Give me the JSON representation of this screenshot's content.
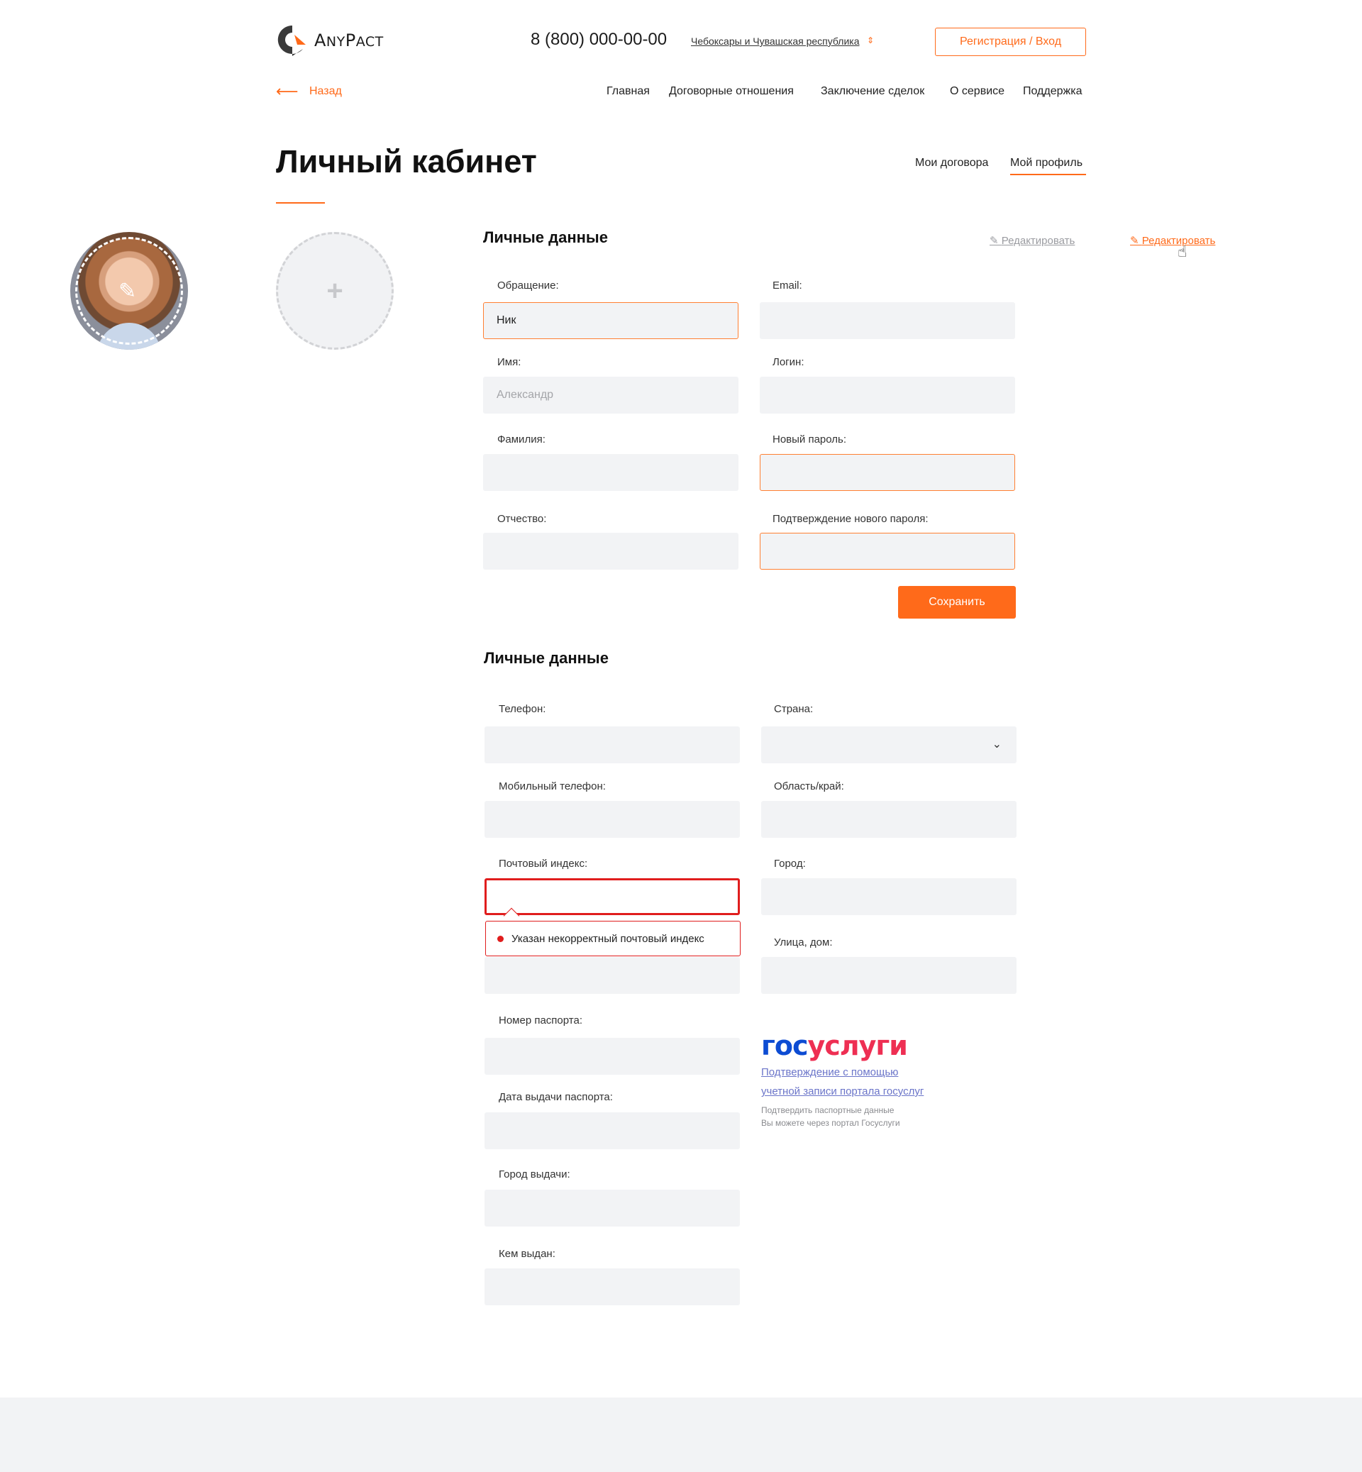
{
  "header": {
    "logo_text_cap1": "A",
    "logo_text_sc1": "NY",
    "logo_text_cap2": "P",
    "logo_text_sc2": "ACT",
    "phone": "8 (800) 000-00-00",
    "region": "Чебоксары и Чувашская республика",
    "auth_button": "Регистрация / Вход"
  },
  "nav": {
    "back": "Назад",
    "items": [
      "Главная",
      "Договорные отношения",
      "Заключение сделок",
      "О сервисе",
      "Поддержка"
    ]
  },
  "page": {
    "title": "Личный кабинет",
    "tabs": [
      "Мои договора",
      "Мой профиль"
    ],
    "active_tab": "Мой профиль"
  },
  "section1": {
    "title": "Личные данные",
    "edit_link": "Редактировать",
    "edit_link_hover": "Редактировать",
    "fields": {
      "salutation": {
        "label": "Обращение:",
        "value": "Ник"
      },
      "email": {
        "label": "Email:",
        "value": ""
      },
      "name": {
        "label": "Имя:",
        "placeholder": "Александр"
      },
      "login": {
        "label": "Логин:",
        "value": ""
      },
      "surname": {
        "label": "Фамилия:",
        "value": ""
      },
      "new_password": {
        "label": "Новый пароль:",
        "value": ""
      },
      "patronymic": {
        "label": "Отчество:",
        "value": ""
      },
      "confirm_password": {
        "label": "Подтверждение нового пароля:",
        "value": ""
      }
    },
    "save_button": "Сохранить"
  },
  "section2": {
    "title": "Личные данные",
    "fields": {
      "phone": {
        "label": "Телефон:"
      },
      "country": {
        "label": "Страна:"
      },
      "mobile": {
        "label": "Мобильный телефон:"
      },
      "region": {
        "label": "Область/край:"
      },
      "postal": {
        "label": "Почтовый индекс:"
      },
      "city": {
        "label": "Город:"
      },
      "street": {
        "label": "Улица, дом:"
      },
      "passport_number": {
        "label": "Номер паспорта:"
      },
      "passport_date": {
        "label": "Дата выдачи паспорта:"
      },
      "issue_city": {
        "label": "Город выдачи:"
      },
      "issued_by": {
        "label": "Кем выдан:"
      }
    },
    "postal_error": "Указан некорректный почтовый индекс",
    "gosuslugi": {
      "logo_part1": "гос",
      "logo_part2": "услуги",
      "link_line1": "Подтверждение с помощью",
      "link_line2": "учетной записи портала госуслуг",
      "note_line1": "Подтвердить паспортные данные",
      "note_line2": "Вы можете через портал Госуслуги"
    }
  },
  "colors": {
    "accent": "#ff6a1a",
    "error": "#e01d1d",
    "field_bg": "#f2f3f5",
    "gos_blue": "#0d4cd3",
    "gos_red": "#ee2f53"
  }
}
